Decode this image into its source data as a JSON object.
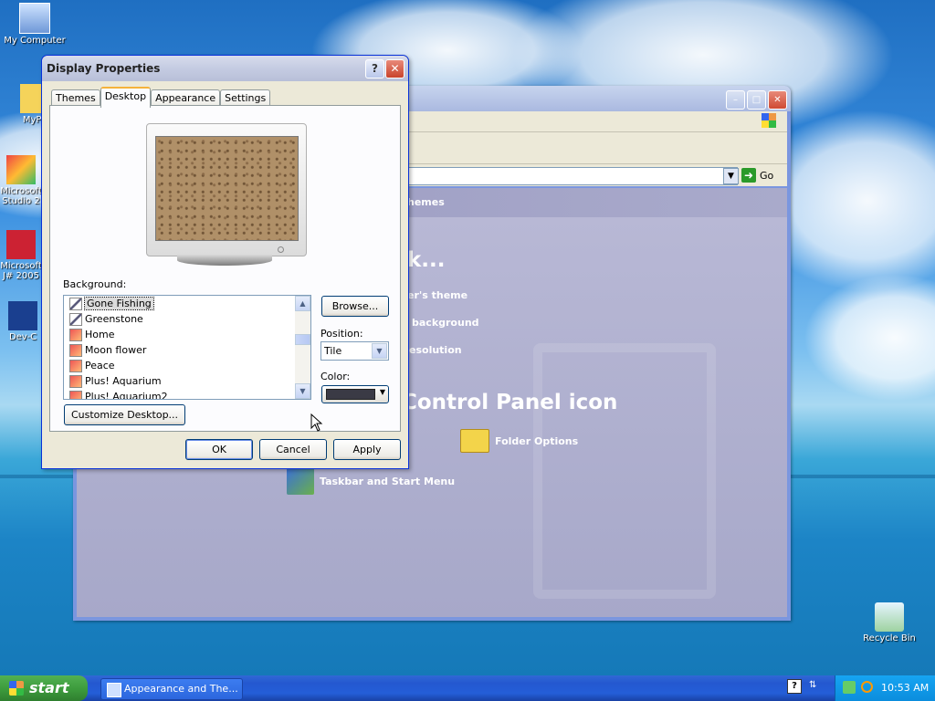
{
  "desktop": {
    "icons": [
      {
        "label": "My Computer"
      },
      {
        "label": "MyPa"
      },
      {
        "label": "Microsoft Studio 2"
      },
      {
        "label": "Microsoft J# 2005"
      },
      {
        "label": "Dev-C"
      }
    ],
    "recycle_bin": "Recycle Bin"
  },
  "control_panel": {
    "go_label": "Go",
    "section_header": "hemes",
    "pick_task_heading": "k...",
    "task_links": [
      "er's theme",
      "background",
      "esolution"
    ],
    "pick_icon_heading": "Control Panel icon",
    "icon_items": [
      "Folder Options",
      "Taskbar and Start Menu"
    ]
  },
  "dialog": {
    "title": "Display Properties",
    "help_glyph": "?",
    "close_glyph": "✕",
    "tabs": [
      "Themes",
      "Desktop",
      "Appearance",
      "Settings"
    ],
    "active_tab": "Desktop",
    "background_label": "Background:",
    "background_items": [
      {
        "name": "Gone Fishing",
        "icon": "ruler-icon",
        "selected": true
      },
      {
        "name": "Greenstone",
        "icon": "ruler-icon"
      },
      {
        "name": "Home",
        "icon": "bitmap-icon"
      },
      {
        "name": "Moon flower",
        "icon": "bitmap-icon"
      },
      {
        "name": "Peace",
        "icon": "bitmap-icon"
      },
      {
        "name": "Plus! Aquarium",
        "icon": "bitmap-icon"
      },
      {
        "name": "Plus! Aquarium2",
        "icon": "bitmap-icon"
      }
    ],
    "browse_label": "Browse...",
    "position_label": "Position:",
    "position_value": "Tile",
    "color_label": "Color:",
    "color_value": "#3a3a45",
    "customize_label": "Customize Desktop...",
    "ok_label": "OK",
    "cancel_label": "Cancel",
    "apply_label": "Apply"
  },
  "taskbar": {
    "start_label": "start",
    "task_item": "Appearance and The...",
    "clock": "10:53 AM"
  }
}
